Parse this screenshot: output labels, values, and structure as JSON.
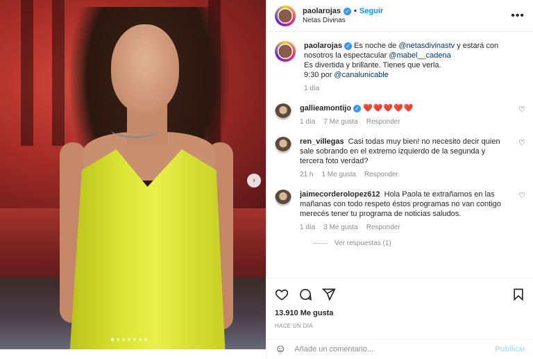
{
  "header": {
    "username": "paolarojas",
    "follow_label": "Seguir",
    "subtitle": "Netas Divinas",
    "more": "•••"
  },
  "caption": {
    "username": "paolarojas",
    "text_1": "Es noche de ",
    "mention_1": "@netasdivinastv",
    "text_2": " y estará con nosotros la espectacular ",
    "mention_2": "@mabel__cadena",
    "line_2": "Es divertida y brillante. Tienes que verla.",
    "text_3": "9:30 por ",
    "mention_3": "@canalunicable",
    "time": "1 día"
  },
  "comments": [
    {
      "username": "gallieamontijo",
      "text": "❤️❤️❤️❤️❤️",
      "time": "1 día",
      "likes": "7 Me gusta",
      "reply": "Responder"
    },
    {
      "username": "ren_villegas",
      "text": "Casi todas muy bien! no necesito decir quien sale sobrando en el extremo izquierdo de la segunda y tercera foto verdad?",
      "time": "21 h",
      "likes": "1 Me gusta",
      "reply": "Responder"
    },
    {
      "username": "jaimecorderolopez612",
      "text": "Hola Paola te extrañamos en las mañanas con todo respeto éstos programas no van contigo merecés tener tu programa de noticias saludos.",
      "time": "1 día",
      "likes": "3 Me gusta",
      "reply": "Responder"
    }
  ],
  "view_replies": "Ver respuestas (1)",
  "likes_count": "13.910 Me gusta",
  "date": "HACE UN DÍA",
  "add_comment": {
    "placeholder": "Añade un comentario...",
    "publish": "Publicar"
  },
  "carousel": {
    "slides": 7,
    "active": 0
  },
  "colors": {
    "accent": "#0095f6",
    "verified": "#3897f0",
    "dress": "#dbe635"
  }
}
